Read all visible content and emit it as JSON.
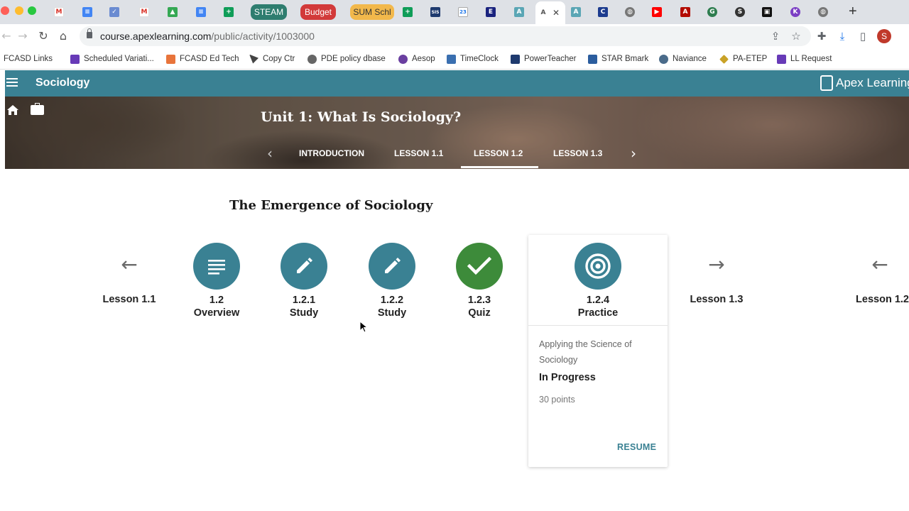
{
  "browser": {
    "pinned_tabs": [
      "STEAM",
      "Budget",
      "SUM Schl"
    ],
    "address": {
      "domain": "course.apexlearning.com",
      "path": "/public/activity/1003000"
    },
    "profile_initial": "S",
    "bookmarks": [
      "FCASD Links",
      "Scheduled Variati...",
      "FCASD Ed Tech",
      "Copy Ctr",
      "PDE policy dbase",
      "Aesop",
      "TimeClock",
      "PowerTeacher",
      "STAR Bmark",
      "Naviance",
      "PA-ETEP",
      "LL Request"
    ],
    "colors": {
      "steam": "#2e7d6f",
      "budget": "#d23a3a",
      "sum": "#f2b84b"
    }
  },
  "app": {
    "course_title": "Sociology",
    "brand": "Apex Learning",
    "unit_title": "Unit 1: What Is Sociology?",
    "lesson_tabs": [
      "INTRODUCTION",
      "LESSON 1.1",
      "LESSON 1.2",
      "LESSON 1.3"
    ],
    "active_tab": "LESSON 1.2",
    "accent": "#3a8193"
  },
  "lesson": {
    "title": "The Emergence of Sociology",
    "prev_link": "Lesson 1.1",
    "next_link": "Lesson 1.3",
    "far_prev_link": "Lesson 1.2",
    "activities": [
      {
        "number": "1.2",
        "name": "Overview",
        "icon": "document-icon"
      },
      {
        "number": "1.2.1",
        "name": "Study",
        "icon": "pencil-icon"
      },
      {
        "number": "1.2.2",
        "name": "Study",
        "icon": "pencil-icon"
      },
      {
        "number": "1.2.3",
        "name": "Quiz",
        "icon": "check-icon"
      },
      {
        "number": "1.2.4",
        "name": "Practice",
        "icon": "target-icon"
      }
    ],
    "card": {
      "description": "Applying the Science of Sociology",
      "status": "In Progress",
      "points": "30 points",
      "action": "RESUME"
    }
  }
}
